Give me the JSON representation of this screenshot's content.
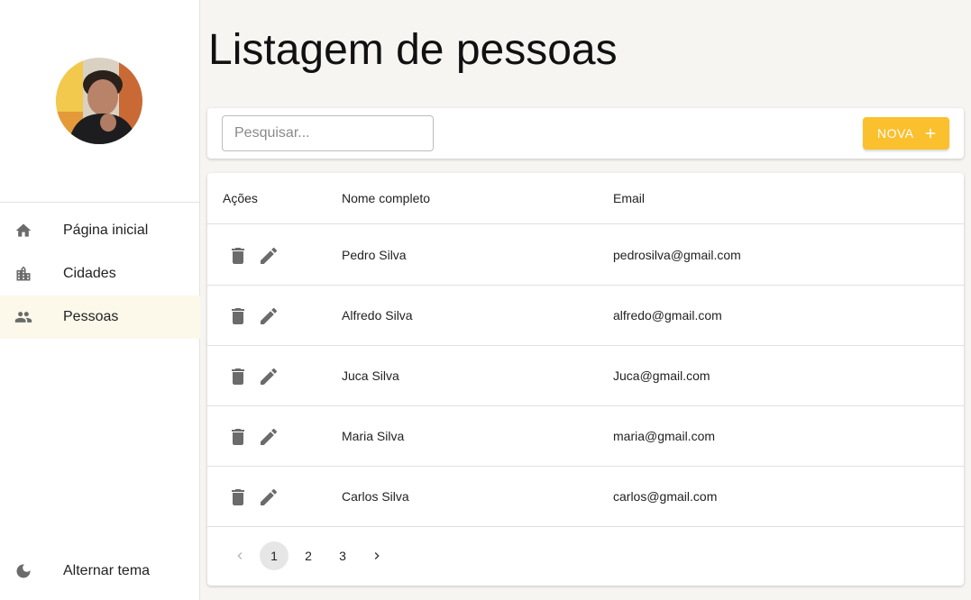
{
  "sidebar": {
    "nav": [
      {
        "label": "Página inicial",
        "icon": "home-icon"
      },
      {
        "label": "Cidades",
        "icon": "city-icon"
      },
      {
        "label": "Pessoas",
        "icon": "people-icon"
      }
    ],
    "theme_toggle": {
      "label": "Alternar tema",
      "icon": "moon-icon"
    }
  },
  "main": {
    "title": "Listagem de pessoas",
    "toolbar": {
      "search_placeholder": "Pesquisar...",
      "new_label": "NOVA",
      "accent": "#fbc02d"
    },
    "table": {
      "headers": {
        "actions": "Ações",
        "name": "Nome completo",
        "email": "Email"
      },
      "rows": [
        {
          "name": "Pedro Silva",
          "email": "pedrosilva@gmail.com"
        },
        {
          "name": "Alfredo Silva",
          "email": "alfredo@gmail.com"
        },
        {
          "name": "Juca Silva",
          "email": "Juca@gmail.com"
        },
        {
          "name": "Maria Silva",
          "email": "maria@gmail.com"
        },
        {
          "name": "Carlos Silva",
          "email": "carlos@gmail.com"
        }
      ]
    },
    "pagination": {
      "pages": [
        "1",
        "2",
        "3"
      ],
      "current": "1"
    }
  }
}
